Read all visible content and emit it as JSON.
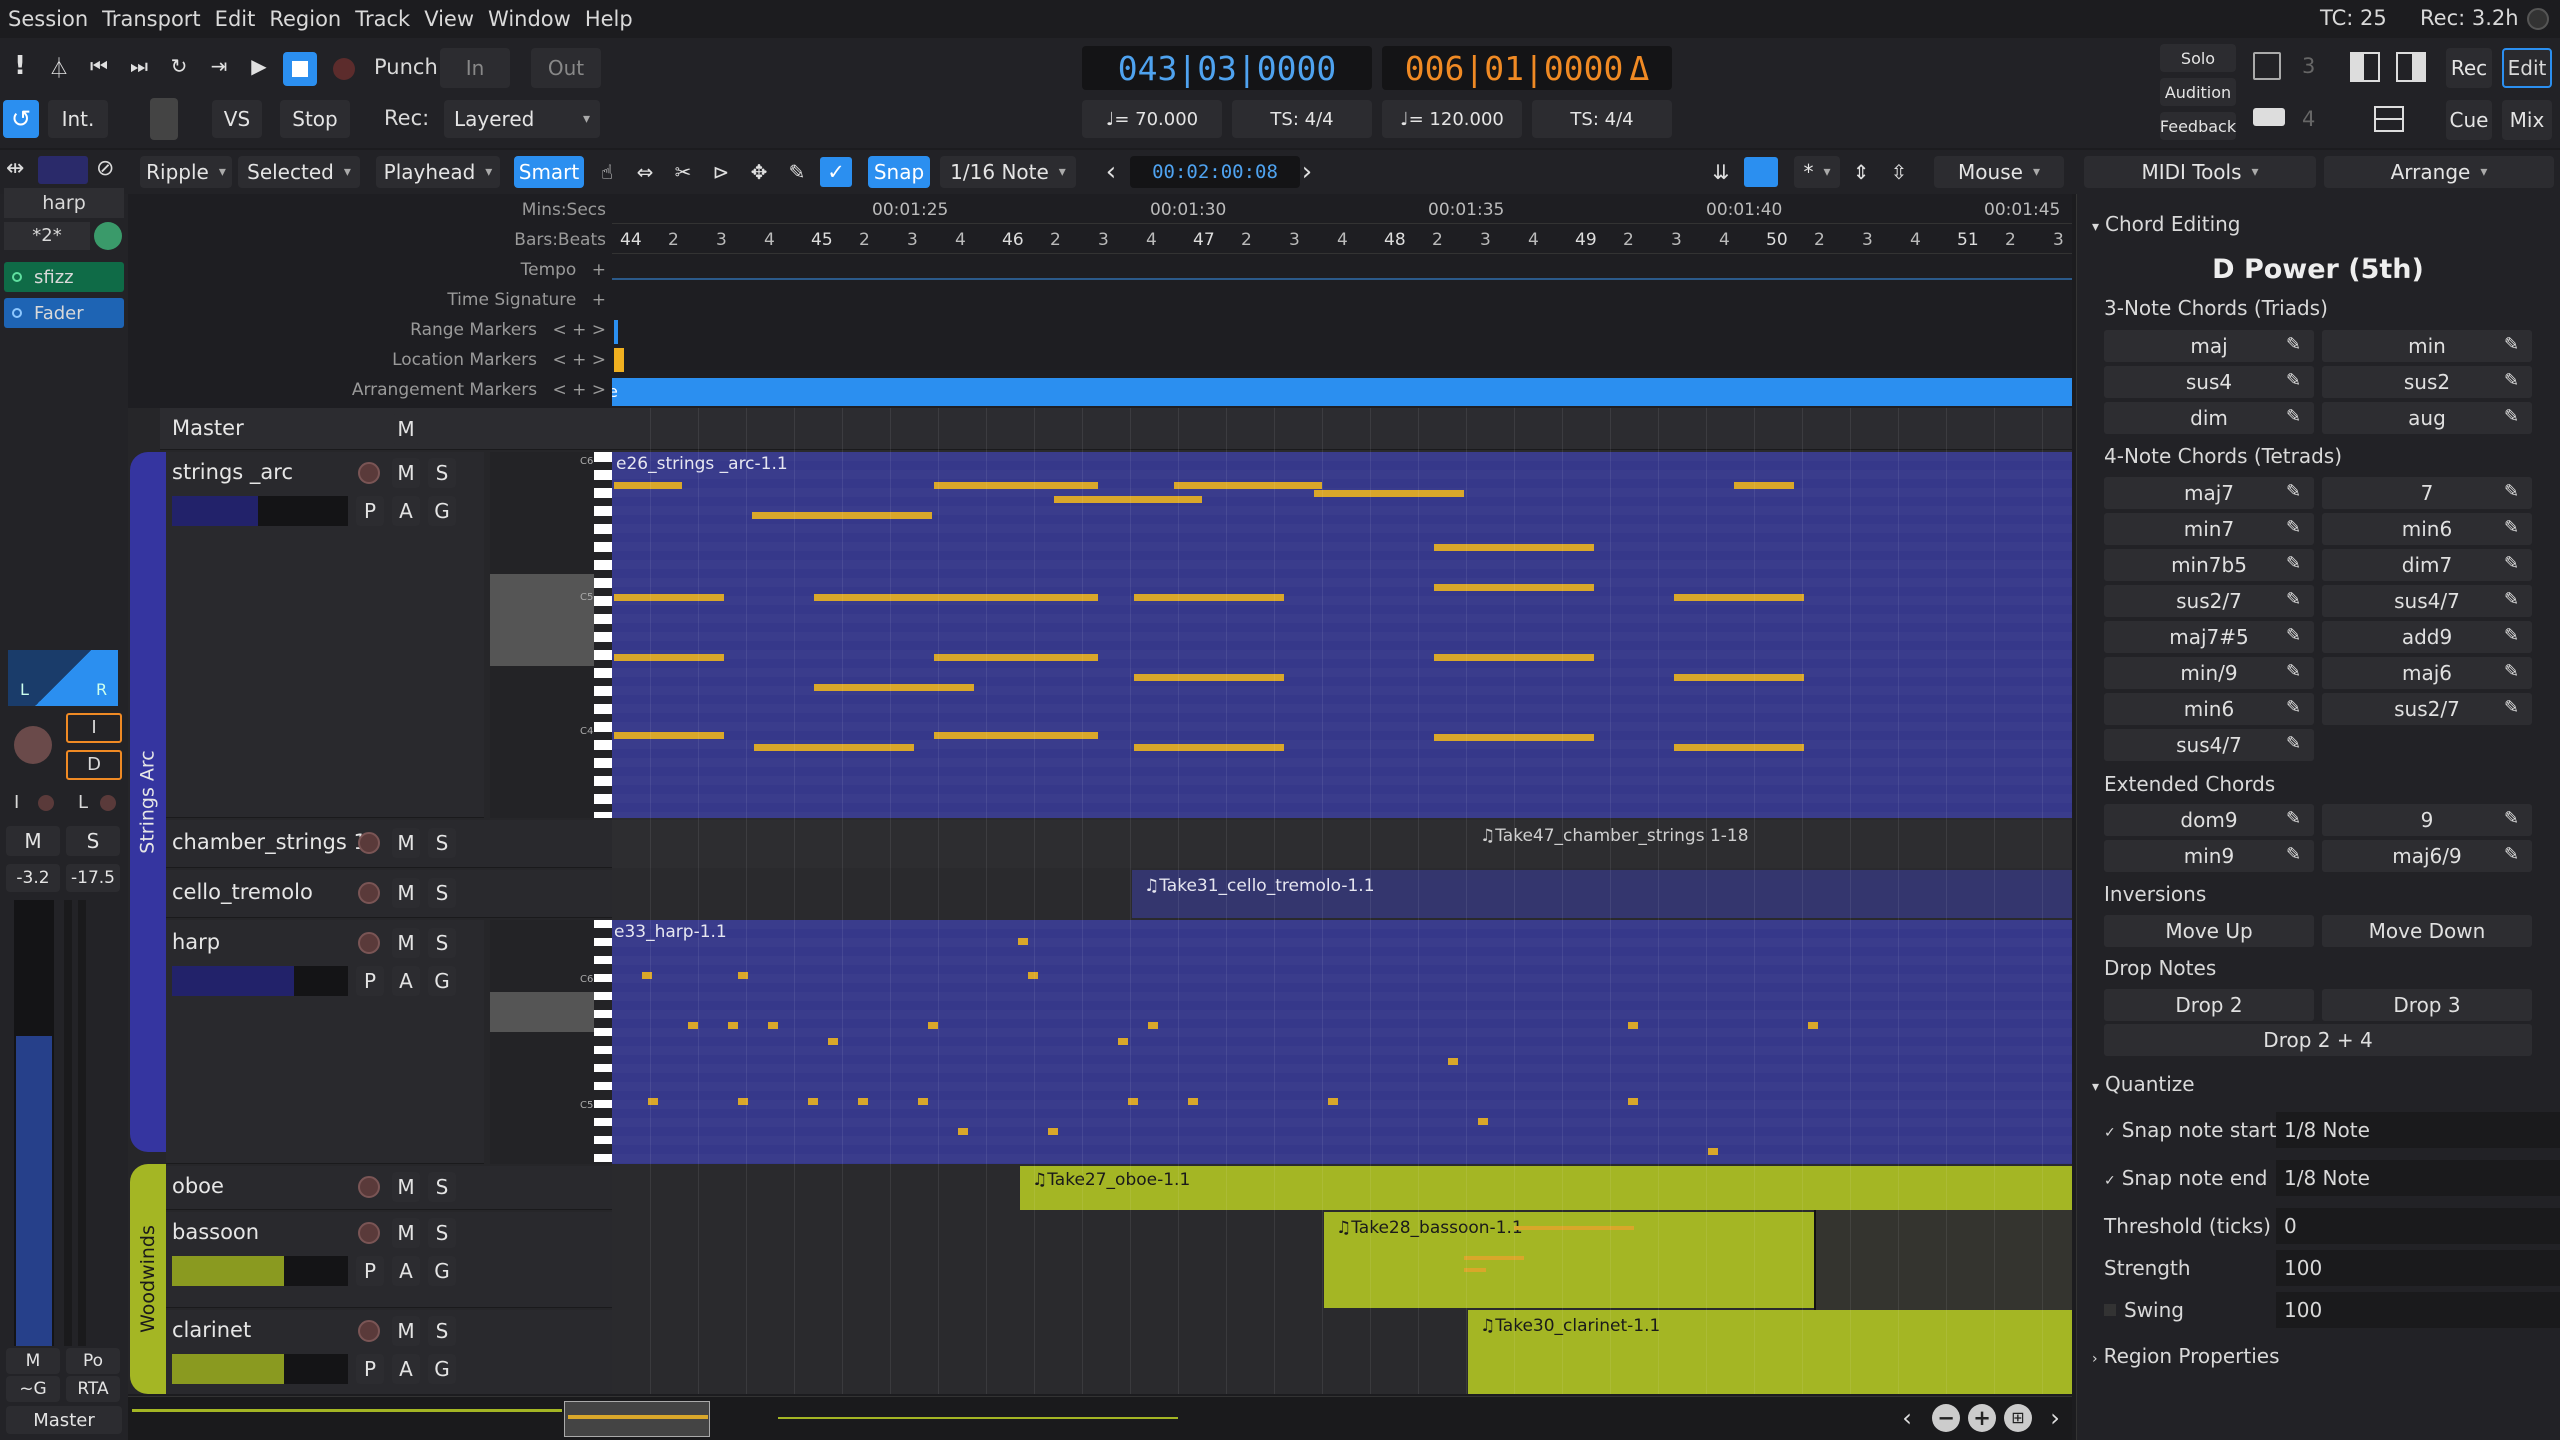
{
  "menubar": {
    "items": [
      "Session",
      "Transport",
      "Edit",
      "Region",
      "Track",
      "View",
      "Window",
      "Help"
    ],
    "tc": "TC: 25",
    "rec": "Rec: 3.2h"
  },
  "transport": {
    "punch_label": "Punch:",
    "punch_in": "In",
    "punch_out": "Out",
    "int_label": "Int.",
    "vs_label": "VS",
    "stop_label": "Stop",
    "rec_label": "Rec:",
    "rec_mode": "Layered",
    "clock1": "043|03|0000",
    "clock2": "006|01|0000",
    "clock2_suffix": "Δ",
    "tempo1": "♩= 70.000",
    "ts1": "TS: 4/4",
    "tempo2": "♩= 120.000",
    "ts2": "TS: 4/4",
    "solo": "Solo",
    "audition": "Audition",
    "feedback": "Feedback",
    "num3": "3",
    "num4": "4",
    "rec_btn": "Rec",
    "edit_btn": "Edit",
    "cue_btn": "Cue",
    "mix_btn": "Mix"
  },
  "toolbar": {
    "ripple": "Ripple",
    "selected": "Selected",
    "playhead": "Playhead",
    "smart": "Smart",
    "snap": "Snap",
    "grid": "1/16 Note",
    "nudge_clock": "00:02:00:08",
    "asterisk": "*",
    "mouse": "Mouse",
    "midi_tools": "MIDI Tools",
    "arrange": "Arrange"
  },
  "rulers": {
    "labels": [
      "Mins:Secs",
      "Bars:Beats",
      "Tempo",
      "Time Signature",
      "Range Markers",
      "Location Markers",
      "Arrangement Markers"
    ],
    "plus": "+",
    "arrows": "<  +  >",
    "times": [
      "00:01:25",
      "00:01:30",
      "00:01:35",
      "00:01:40",
      "00:01:45"
    ],
    "bars": [
      "44",
      "45",
      "46",
      "47",
      "48",
      "49",
      "50",
      "51"
    ],
    "beats": [
      "2",
      "3",
      "4"
    ]
  },
  "left_strip": {
    "track_name": "harp",
    "preset": "*2*",
    "plugin1": "sfizz",
    "plugin2": "Fader",
    "L": "L",
    "R": "R",
    "I": "I",
    "D": "D",
    "I2": "I",
    "L2": "L",
    "M": "M",
    "S": "S",
    "gain_left": "-3.2",
    "gain_right": "-17.5",
    "M2": "M",
    "Po": "Po",
    "G": "~G",
    "RTA": "RTA",
    "master": "Master"
  },
  "tracks": {
    "master": "Master",
    "m": "M",
    "s": "S",
    "p": "P",
    "a": "A",
    "g": "G",
    "group1": "Strings Arc",
    "group2": "Woodwinds",
    "strings_arc": "strings _arc",
    "chamber": "chamber_strings 1",
    "cello": "cello_tremolo",
    "harp": "harp",
    "oboe": "oboe",
    "bassoon": "bassoon",
    "clarinet": "clarinet"
  },
  "regions": {
    "strings": "e26_strings _arc-1.1",
    "chamber": "♫Take47_chamber_strings 1-18",
    "cello": "♫Take31_cello_tremolo-1.1",
    "harp": "e33_harp-1.1",
    "oboe": "♫Take27_oboe-1.1",
    "bassoon": "♫Take28_bassoon-1.1",
    "clarinet": "♫Take30_clarinet-1.1",
    "range_e": "e"
  },
  "keys": {
    "c6": "C6",
    "c5": "C5",
    "c4": "C4"
  },
  "midi_tools": {
    "section_chord": "Chord Editing",
    "chord_name": "D Power (5th)",
    "triads_header": "3-Note Chords (Triads)",
    "triads": [
      "maj",
      "min",
      "sus4",
      "sus2",
      "dim",
      "aug"
    ],
    "tetrads_header": "4-Note Chords (Tetrads)",
    "tetrads": [
      "maj7",
      "7",
      "min7",
      "min6",
      "min7b5",
      "dim7",
      "sus2/7",
      "sus4/7",
      "maj7#5",
      "add9",
      "min/9",
      "maj6",
      "min6",
      "sus2/7",
      "sus4/7"
    ],
    "extended_header": "Extended Chords",
    "extended": [
      "dom9",
      "9",
      "min9",
      "maj6/9"
    ],
    "inversions_header": "Inversions",
    "move_up": "Move Up",
    "move_down": "Move Down",
    "drop_header": "Drop Notes",
    "drop2": "Drop 2",
    "drop3": "Drop 3",
    "drop24": "Drop 2 + 4",
    "quantize": "Quantize",
    "snap_start": "Snap note start",
    "snap_start_val": "1/8 Note",
    "snap_end": "Snap note end",
    "snap_end_val": "1/8 Note",
    "threshold": "Threshold (ticks)",
    "threshold_val": "0",
    "strength": "Strength",
    "strength_val": "100",
    "swing": "Swing",
    "swing_val": "100",
    "region_props": "Region Properties"
  },
  "colors": {
    "accent": "#2b8ff0",
    "midi_region": "#3a3c8c",
    "note": "#d9a72a",
    "woodwind": "#a4b624",
    "clock_blue": "#4fa3f0",
    "clock_orange": "#f08a24"
  }
}
